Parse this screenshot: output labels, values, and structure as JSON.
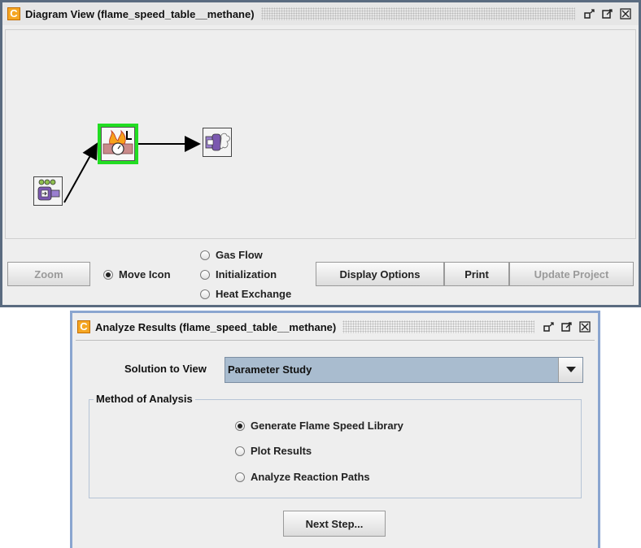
{
  "diagram_window": {
    "title": "Diagram View  (flame_speed_table__methane)",
    "logo_letter": "C",
    "zoom_label": "Zoom",
    "move_icon_label": "Move Icon",
    "radio_options": [
      "Gas Flow",
      "Initialization",
      "Heat Exchange"
    ],
    "display_options_label": "Display Options",
    "print_label": "Print",
    "update_project_label": "Update Project",
    "selected_node_color": "#22dd22"
  },
  "analyze_window": {
    "title": "Analyze Results  (flame_speed_table__methane)",
    "logo_letter": "C",
    "solution_label": "Solution to View",
    "solution_value": "Parameter Study",
    "method_group_label": "Method of Analysis",
    "methods": [
      "Generate Flame Speed Library",
      "Plot Results",
      "Analyze Reaction Paths"
    ],
    "selected_method_index": 0,
    "next_step_label": "Next Step...",
    "accent_border": "#8aa5d0"
  }
}
